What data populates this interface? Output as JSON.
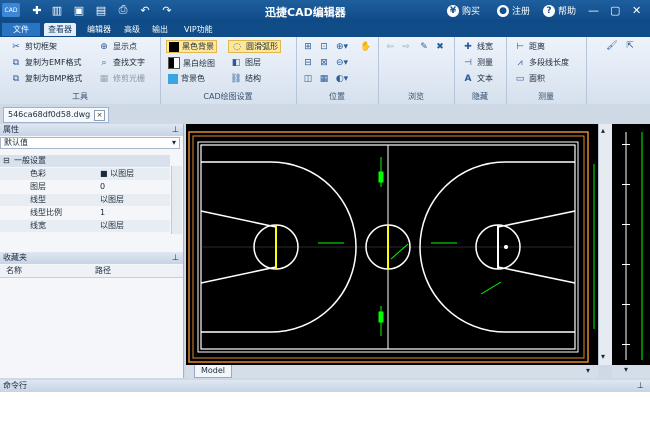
{
  "titlebar": {
    "logo_text": "CAD",
    "app_title": "迅捷CAD编辑器",
    "buy_label": "购买",
    "register_label": "注册",
    "help_label": "帮助",
    "quick_access_icons": [
      "new-icon",
      "open-icon",
      "save-icon",
      "save-as-icon",
      "print-icon",
      "undo-icon",
      "redo-icon"
    ]
  },
  "menu": {
    "file": "文件",
    "tabs": [
      "查看器",
      "编辑器",
      "高级",
      "输出",
      "VIP功能"
    ],
    "active_index": 0
  },
  "ribbon": {
    "tools": {
      "label": "工具",
      "items": [
        "剪切框架",
        "复制为EMF格式",
        "复制为BMP格式",
        "显示点",
        "查找文字",
        "修剪光栅"
      ]
    },
    "cad_settings": {
      "label": "CAD绘图设置",
      "items": [
        "黑色背景",
        "黑白绘图",
        "背景色",
        "圆滑弧形",
        "图层",
        "结构"
      ]
    },
    "position": {
      "label": "位置"
    },
    "browse": {
      "label": "浏览"
    },
    "hide": {
      "label": "隐藏",
      "items": [
        "线宽",
        "测量",
        "文本"
      ]
    },
    "measure": {
      "label": "测量",
      "items": [
        "距离",
        "多段线长度",
        "面积"
      ]
    }
  },
  "document": {
    "tab_name": "546ca68df0d58.dwg"
  },
  "properties": {
    "header": "属性",
    "selector_value": "默认值",
    "section": "一般设置",
    "rows": [
      {
        "key": "色彩",
        "value": "■ 以图层"
      },
      {
        "key": "图层",
        "value": "0"
      },
      {
        "key": "线型",
        "value": "以图层"
      },
      {
        "key": "线型比例",
        "value": "1"
      },
      {
        "key": "线宽",
        "value": "以图层"
      }
    ]
  },
  "favorites": {
    "header": "收藏夹",
    "col_name": "名称",
    "col_path": "路径"
  },
  "model_tab": "Model",
  "command": {
    "header": "命令行"
  },
  "colors": {
    "titlebar": "#0e4a86",
    "canvas": "#000000",
    "court_lines": "#ffffff",
    "key_marks": "#ffff00",
    "dimensions": "#00ff00",
    "frame": "#e08a30"
  }
}
